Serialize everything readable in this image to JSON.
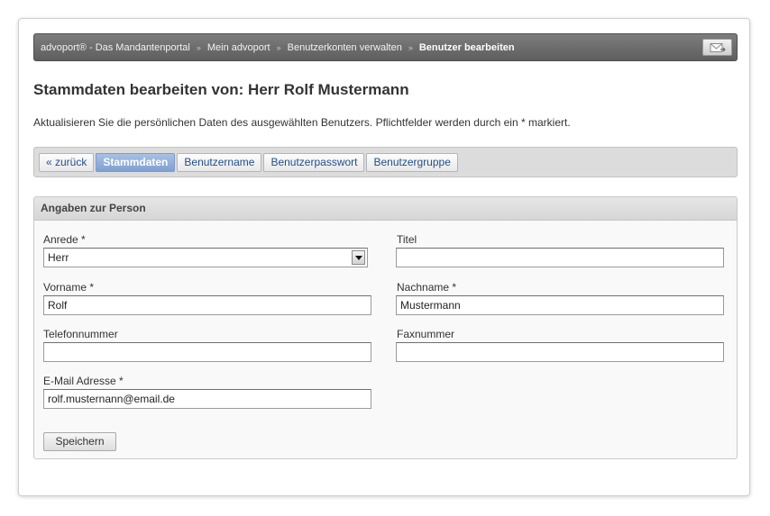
{
  "breadcrumb": {
    "items": [
      "advoport® - Das Mandantenportal",
      "Mein advoport",
      "Benutzerkonten verwalten"
    ],
    "current": "Benutzer bearbeiten",
    "separator": "»"
  },
  "page": {
    "title": "Stammdaten bearbeiten von: Herr Rolf Mustermann",
    "intro": "Aktualisieren Sie die persönlichen Daten des ausgewählten Benutzers. Pflichtfelder werden durch ein * markiert."
  },
  "tabs": {
    "back": "« zurück",
    "stammdaten": "Stammdaten",
    "benutzername": "Benutzername",
    "benutzerpasswort": "Benutzerpasswort",
    "benutzergruppe": "Benutzergruppe"
  },
  "panel": {
    "title": "Angaben zur Person"
  },
  "form": {
    "anrede": {
      "label": "Anrede *",
      "value": "Herr"
    },
    "titel": {
      "label": "Titel",
      "value": ""
    },
    "vorname": {
      "label": "Vorname *",
      "value": "Rolf"
    },
    "nachname": {
      "label": "Nachname *",
      "value": "Mustermann"
    },
    "telefon": {
      "label": "Telefonnummer",
      "value": ""
    },
    "fax": {
      "label": "Faxnummer",
      "value": ""
    },
    "email": {
      "label": "E-Mail Adresse *",
      "value": "rolf.musternann@email.de"
    },
    "save": "Speichern"
  },
  "colors": {
    "accent": "#7fa0d2",
    "link": "#1f4e8c",
    "breadcrumb_bg": "#6b6b6b"
  },
  "icons": {
    "mail": "envelope-arrow-icon",
    "select": "triangle-down-icon"
  }
}
